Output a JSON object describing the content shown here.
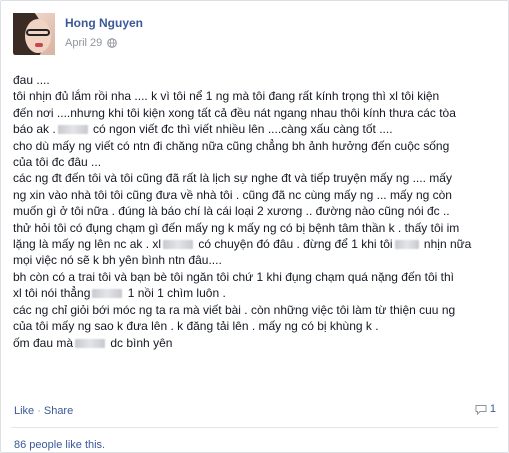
{
  "post": {
    "author": "Hong Nguyen",
    "date": "April 29",
    "privacy_icon": "globe-icon",
    "lines": [
      [
        "đau ...."
      ],
      [
        "tôi nhịn đủ lắm rồi nha .... k vì tôi nể 1 ng mà tôi đang rất kính trọng thì xl tôi kiện"
      ],
      [
        "đến nơi ....nhưng khi tôi kiện xong tất cả đều nát ngang nhau thôi kính thưa các tòa"
      ],
      [
        "báo ak .",
        " có ngon viết đc thì viết nhiều lên ....càng xấu càng tốt ...."
      ],
      [
        "cho dù mấy ng viết có ntn đi chăng nữa cũng chẳng bh ảnh hưởng đến cuộc sống"
      ],
      [
        "của tôi đc đâu ..."
      ],
      [
        "các ng đt đến tôi và tôi cũng đã rất là lịch sự nghe đt và tiếp truyện mấy ng .... mấy"
      ],
      [
        "ng xin vào nhà tôi tôi cũng đưa về nhà tôi . cũng đã nc cùng mấy ng ... mấy ng còn"
      ],
      [
        "muốn gì ở tôi nữa . đúng là báo chí là cái loại 2 xương .. đường nào cũng nói đc .."
      ],
      [
        "thử hỏi tôi có đụng chạm gì đến mấy ng k mấy ng có bị bệnh tâm thần k . thấy tôi im"
      ],
      [
        "lặng là mấy ng lên nc ak . xl",
        " có chuyện đó đâu . đừng để 1 khi tôi",
        " nhịn nữa"
      ],
      [
        "mọi việc nó sẽ k bh yên bình ntn đâu...."
      ],
      [
        "bh còn có a trai tôi và bạn bè tôi ngăn tôi chứ 1 khi đụng chạm quá nặng đến tôi thì"
      ],
      [
        "xl tôi nói thẳng",
        " 1 nồi 1 chìm luôn ."
      ],
      [
        "các ng chỉ giỏi bới móc ng ta ra mà viết bài . còn những việc tôi làm từ thiện cuu ng"
      ],
      [
        "của tôi mấy ng sao k đưa lên . k đăng tải lên . mấy ng có bị khùng k ."
      ],
      [
        "ốm đau mà",
        " dc bình yên"
      ]
    ]
  },
  "actions": {
    "like": "Like",
    "separator": "·",
    "share": "Share",
    "comment_icon": "comment-icon",
    "comment_count": "1"
  },
  "likes_text": "86 people like this."
}
